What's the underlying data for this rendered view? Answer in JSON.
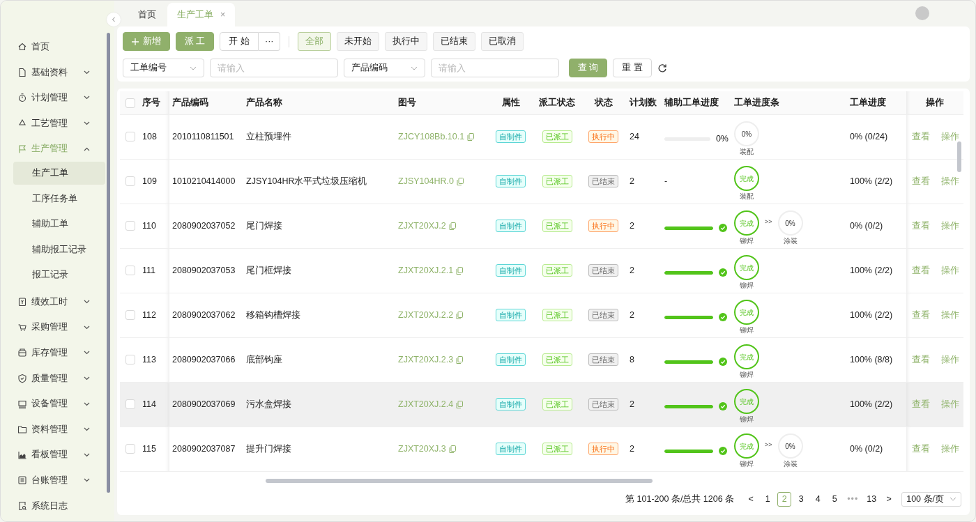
{
  "tabs": [
    {
      "label": "首页",
      "selected": false,
      "closable": false
    },
    {
      "label": "生产工单",
      "selected": true,
      "closable": true,
      "close": "×"
    }
  ],
  "sidebar": {
    "items": [
      {
        "label": "首页",
        "expandable": false,
        "expanded": false,
        "selected": false
      },
      {
        "label": "基础资料",
        "expandable": true,
        "expanded": false,
        "selected": false
      },
      {
        "label": "计划管理",
        "expandable": true,
        "expanded": false,
        "selected": false
      },
      {
        "label": "工艺管理",
        "expandable": true,
        "expanded": false,
        "selected": false
      },
      {
        "label": "生产管理",
        "expandable": true,
        "expanded": true,
        "selected": true,
        "children": [
          {
            "label": "生产工单",
            "selected": true
          },
          {
            "label": "工序任务单",
            "selected": false
          },
          {
            "label": "辅助工单",
            "selected": false
          },
          {
            "label": "辅助报工记录",
            "selected": false
          },
          {
            "label": "报工记录",
            "selected": false
          }
        ]
      },
      {
        "label": "绩效工时",
        "expandable": true,
        "expanded": false,
        "selected": false
      },
      {
        "label": "采购管理",
        "expandable": true,
        "expanded": false,
        "selected": false
      },
      {
        "label": "库存管理",
        "expandable": true,
        "expanded": false,
        "selected": false
      },
      {
        "label": "质量管理",
        "expandable": true,
        "expanded": false,
        "selected": false
      },
      {
        "label": "设备管理",
        "expandable": true,
        "expanded": false,
        "selected": false
      },
      {
        "label": "资料管理",
        "expandable": true,
        "expanded": false,
        "selected": false
      },
      {
        "label": "看板管理",
        "expandable": true,
        "expanded": false,
        "selected": false
      },
      {
        "label": "台账管理",
        "expandable": true,
        "expanded": false,
        "selected": false
      },
      {
        "label": "系统日志",
        "expandable": false,
        "expanded": false,
        "selected": false
      }
    ]
  },
  "toolbar": {
    "actions": [
      {
        "kind": "add",
        "label": "新增"
      },
      {
        "kind": "primary",
        "label": "派 工"
      },
      {
        "kind": "split",
        "label": "开 始",
        "more": "···"
      }
    ],
    "filters": [
      {
        "label": "全部",
        "selected": true
      },
      {
        "label": "未开始",
        "selected": false
      },
      {
        "label": "执行中",
        "selected": false
      },
      {
        "label": "已结束",
        "selected": false
      },
      {
        "label": "已取消",
        "selected": false
      }
    ]
  },
  "search": {
    "fields": [
      {
        "kind": "select",
        "value": "工单编号"
      },
      {
        "kind": "input",
        "placeholder": "请输入"
      },
      {
        "kind": "select",
        "value": "产品编码"
      },
      {
        "kind": "input",
        "placeholder": "请输入"
      }
    ],
    "buttons": [
      {
        "kind": "primary",
        "label": "查 询"
      },
      {
        "kind": "default",
        "label": "重 置"
      }
    ]
  },
  "table": {
    "select_all": {
      "checked": false
    },
    "columns": [
      "序号",
      "产品编码",
      "产品名称",
      "图号",
      "属性",
      "派工状态",
      "状态",
      "计划数",
      "辅助工单进度",
      "工单进度条",
      "工单进度",
      "操作"
    ],
    "rows": [
      {
        "checked": false,
        "hovered": false,
        "no": "108",
        "code": "2010110811501",
        "name": "立柱预埋件",
        "drawing": "ZJCY108Bb.10.1",
        "attribute": "自制件",
        "dispatch": "已派工",
        "status": {
          "kind": "running",
          "text": "执行中"
        },
        "plan": "24",
        "aux": {
          "kind": "bar",
          "level": 0,
          "done": false,
          "reading": "0%"
        },
        "steps": [
          {
            "done": false,
            "text": "0%",
            "label": "装配"
          }
        ],
        "progress": "0% (0/24)",
        "actions": [
          "查看",
          "操作"
        ]
      },
      {
        "checked": false,
        "hovered": false,
        "no": "109",
        "code": "1010210414000",
        "name": "ZJSY104HR水平式垃圾压缩机",
        "drawing": "ZJSY104HR.0",
        "attribute": "自制件",
        "dispatch": "已派工",
        "status": {
          "kind": "finished",
          "text": "已结束"
        },
        "plan": "2",
        "aux": {
          "kind": "empty",
          "text": "-"
        },
        "steps": [
          {
            "done": true,
            "text": "完成",
            "label": "装配"
          }
        ],
        "progress": "100% (2/2)",
        "actions": [
          "查看",
          "操作"
        ]
      },
      {
        "checked": false,
        "hovered": false,
        "no": "110",
        "code": "2080902037052",
        "name": "尾门焊接",
        "drawing": "ZJXT20XJ.2",
        "attribute": "自制件",
        "dispatch": "已派工",
        "status": {
          "kind": "running",
          "text": "执行中"
        },
        "plan": "2",
        "aux": {
          "kind": "bar",
          "level": 1,
          "done": true
        },
        "steps": [
          {
            "done": true,
            "text": "完成",
            "label": "铆焊"
          },
          {
            "before": ">>",
            "done": false,
            "text": "0%",
            "label": "涂装"
          }
        ],
        "progress": "0% (0/2)",
        "actions": [
          "查看",
          "操作"
        ]
      },
      {
        "checked": false,
        "hovered": false,
        "no": "111",
        "code": "2080902037053",
        "name": "尾门框焊接",
        "drawing": "ZJXT20XJ.2.1",
        "attribute": "自制件",
        "dispatch": "已派工",
        "status": {
          "kind": "finished",
          "text": "已结束"
        },
        "plan": "2",
        "aux": {
          "kind": "bar",
          "level": 1,
          "done": true
        },
        "steps": [
          {
            "done": true,
            "text": "完成",
            "label": "铆焊"
          }
        ],
        "progress": "100% (2/2)",
        "actions": [
          "查看",
          "操作"
        ]
      },
      {
        "checked": false,
        "hovered": false,
        "no": "112",
        "code": "2080902037062",
        "name": "移箱钩槽焊接",
        "drawing": "ZJXT20XJ.2.2",
        "attribute": "自制件",
        "dispatch": "已派工",
        "status": {
          "kind": "finished",
          "text": "已结束"
        },
        "plan": "2",
        "aux": {
          "kind": "bar",
          "level": 1,
          "done": true
        },
        "steps": [
          {
            "done": true,
            "text": "完成",
            "label": "铆焊"
          }
        ],
        "progress": "100% (2/2)",
        "actions": [
          "查看",
          "操作"
        ]
      },
      {
        "checked": false,
        "hovered": false,
        "no": "113",
        "code": "2080902037066",
        "name": "底部钩座",
        "drawing": "ZJXT20XJ.2.3",
        "attribute": "自制件",
        "dispatch": "已派工",
        "status": {
          "kind": "finished",
          "text": "已结束"
        },
        "plan": "8",
        "aux": {
          "kind": "bar",
          "level": 1,
          "done": true
        },
        "steps": [
          {
            "done": true,
            "text": "完成",
            "label": "铆焊"
          }
        ],
        "progress": "100% (8/8)",
        "actions": [
          "查看",
          "操作"
        ]
      },
      {
        "checked": false,
        "hovered": true,
        "no": "114",
        "code": "2080902037069",
        "name": "污水盒焊接",
        "drawing": "ZJXT20XJ.2.4",
        "attribute": "自制件",
        "dispatch": "已派工",
        "status": {
          "kind": "finished",
          "text": "已结束"
        },
        "plan": "2",
        "aux": {
          "kind": "bar",
          "level": 1,
          "done": true
        },
        "steps": [
          {
            "done": true,
            "text": "完成",
            "label": "铆焊"
          }
        ],
        "progress": "100% (2/2)",
        "actions": [
          "查看",
          "操作"
        ]
      },
      {
        "checked": false,
        "hovered": false,
        "no": "115",
        "code": "2080902037087",
        "name": "提升门焊接",
        "drawing": "ZJXT20XJ.3",
        "attribute": "自制件",
        "dispatch": "已派工",
        "status": {
          "kind": "running",
          "text": "执行中"
        },
        "plan": "2",
        "aux": {
          "kind": "bar",
          "level": 1,
          "done": true
        },
        "steps": [
          {
            "done": true,
            "text": "完成",
            "label": "铆焊"
          },
          {
            "before": ">>",
            "done": false,
            "text": "0%",
            "label": "涂装"
          }
        ],
        "progress": "0% (0/2)",
        "actions": [
          "查看",
          "操作"
        ]
      }
    ]
  },
  "pagination": {
    "summary": "第 101-200 条/总共 1206 条",
    "prev": "<",
    "next": ">",
    "pages": [
      {
        "label": "1",
        "selected": false
      },
      {
        "label": "2",
        "selected": true
      },
      {
        "label": "3",
        "selected": false
      },
      {
        "label": "4",
        "selected": false
      },
      {
        "label": "5",
        "selected": false
      },
      {
        "label": "•••",
        "kind": "ellipsis",
        "selected": false
      },
      {
        "label": "13",
        "selected": false
      }
    ],
    "page_size": "100 条/页"
  }
}
